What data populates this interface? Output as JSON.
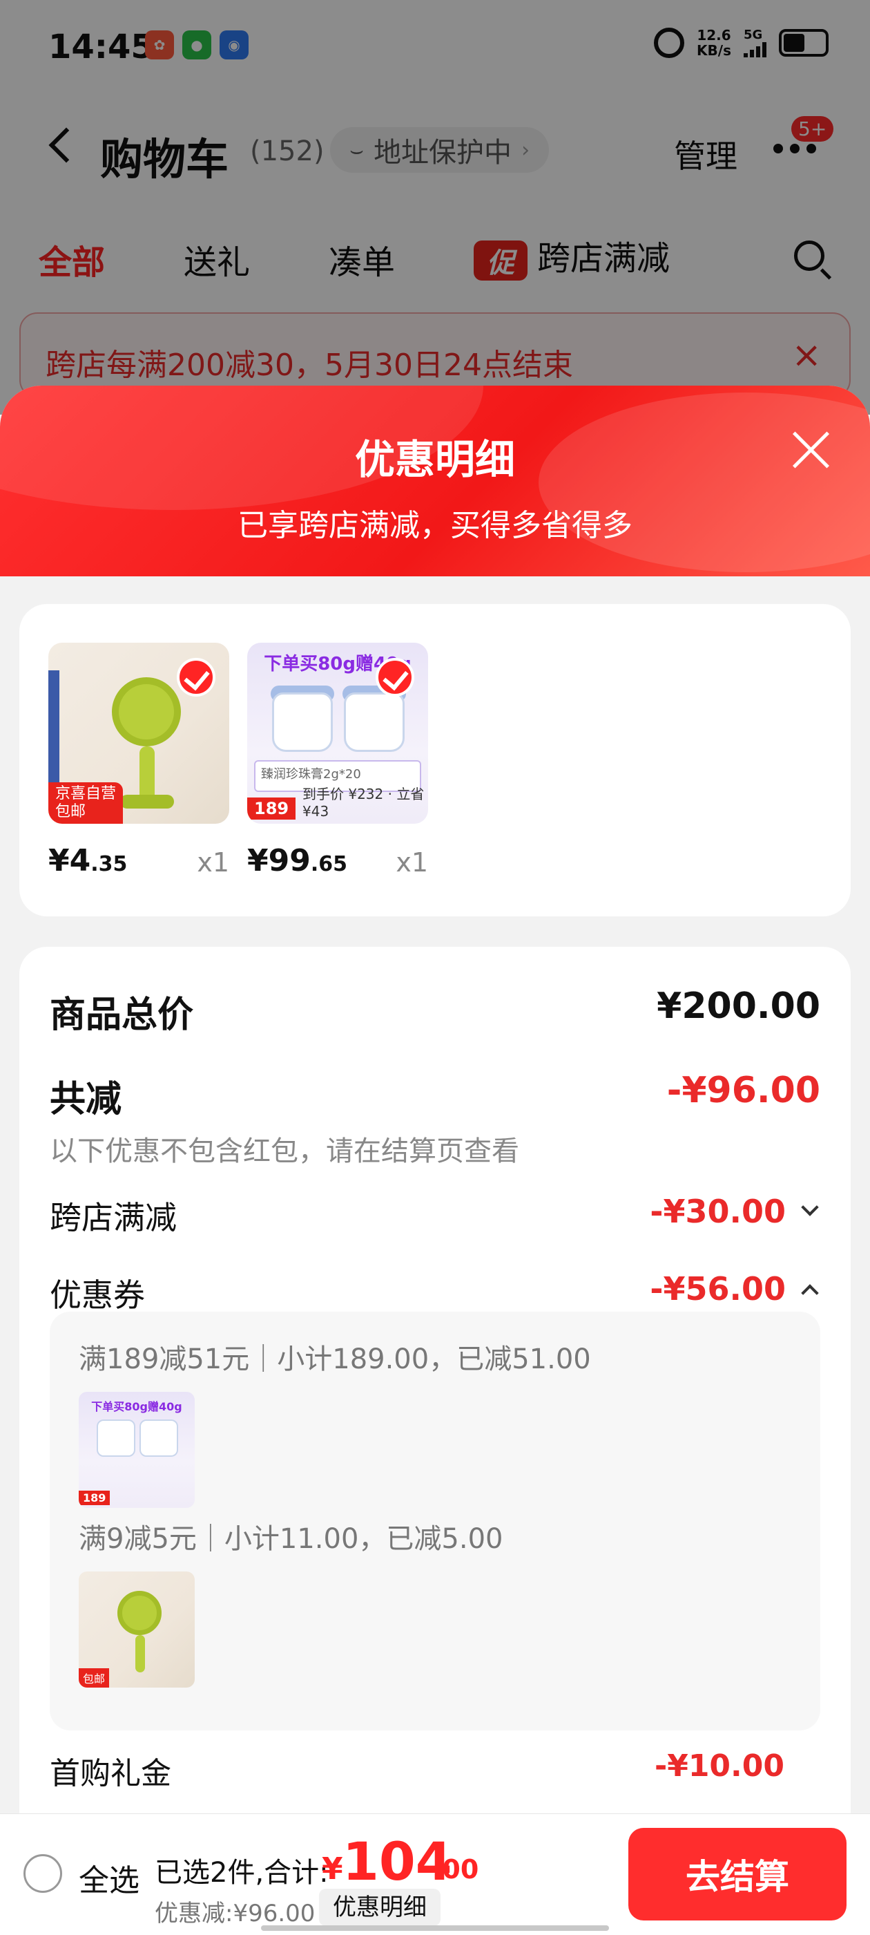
{
  "status_bar": {
    "time": "14:45",
    "net_speed": "12.6",
    "net_unit": "KB/s",
    "signal": "5G"
  },
  "cart_nav": {
    "title": "购物车",
    "count": "(152)",
    "address_pill": "地址保护中",
    "manage": "管理",
    "badge": "5+"
  },
  "tabs": [
    {
      "label": "全部",
      "active": true
    },
    {
      "label": "送礼",
      "active": false
    },
    {
      "label": "凑单",
      "active": false
    },
    {
      "label": "跨店满减",
      "active": false,
      "tag": "促"
    }
  ],
  "notice": {
    "text": "跨店每满200减30，5月30日24点结束",
    "close": "×"
  },
  "sheet": {
    "title": "优惠明细",
    "subtitle": "已享跨店满减，买得多省得多"
  },
  "products": [
    {
      "name": "fan",
      "price_int": "¥4",
      "price_dec": ".35",
      "qty": "x1",
      "tag_line1": "京喜自营",
      "tag_line2": "包邮"
    },
    {
      "name": "cream",
      "price_int": "¥99",
      "price_dec": ".65",
      "qty": "x1",
      "img_headline": "下单买80g赠40g",
      "img_price": "189",
      "img_line": "臻润珍珠膏2g*20",
      "img_after": "到手价 ¥232 · 立省 ¥43"
    }
  ],
  "summary": {
    "total_label": "商品总价",
    "total_value": "¥200.00",
    "reduce_label": "共减",
    "reduce_value": "-¥96.00",
    "reduce_hint": "以下优惠不包含红包，请在结算页查看",
    "cross_label": "跨店满减",
    "cross_value": "-¥30.00",
    "coupon_label": "优惠券",
    "coupon_value": "-¥56.00",
    "coupon1": "满189减51元｜小计189.00，已减51.00",
    "coupon2": "满9减5元｜小计11.00，已减5.00",
    "partial_label": "首购礼金",
    "partial_value": "-¥10.00"
  },
  "bottom": {
    "select_all": "全选",
    "selected": "已选2件,合计:",
    "total_cur": "¥",
    "total_int": "104",
    "total_dec": ".00",
    "discount": "优惠减:¥96.00",
    "detail_btn": "优惠明细",
    "checkout": "去结算"
  },
  "colors": {
    "accent": "#ff2424",
    "sheet_header": "#f21818",
    "checkout": "#ff2d2d"
  }
}
